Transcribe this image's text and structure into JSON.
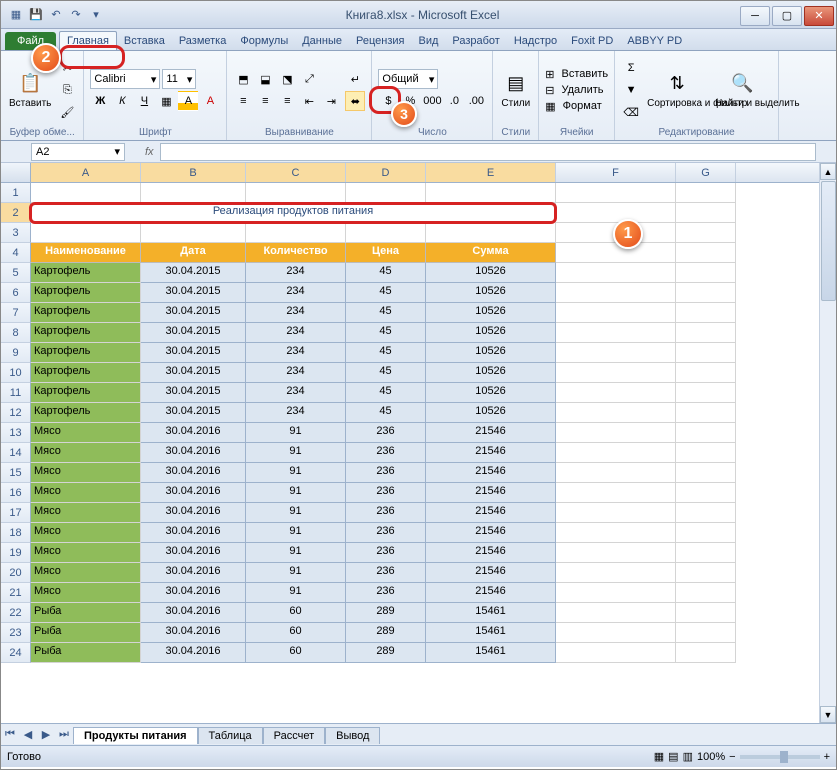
{
  "window": {
    "title": "Книга8.xlsx - Microsoft Excel"
  },
  "qat": {
    "save": "💾",
    "undo": "↶",
    "redo": "↷"
  },
  "tabs": {
    "file": "Файл",
    "items": [
      "Главная",
      "Вставка",
      "Разметка",
      "Формулы",
      "Данные",
      "Рецензия",
      "Вид",
      "Разработ",
      "Надстро",
      "Foxit PD",
      "ABBYY PD"
    ],
    "active": 0
  },
  "ribbon": {
    "clipboard": {
      "title": "Буфер обме...",
      "paste": "Вставить"
    },
    "font": {
      "title": "Шрифт",
      "name": "Calibri",
      "size": "11",
      "bold": "Ж",
      "italic": "К",
      "underline": "Ч"
    },
    "alignment": {
      "title": "Выравнивание"
    },
    "number": {
      "title": "Число",
      "format": "Общий"
    },
    "styles": {
      "title": "Стили",
      "label": "Стили"
    },
    "cells": {
      "title": "Ячейки",
      "insert": "Вставить",
      "delete": "Удалить",
      "format": "Формат"
    },
    "editing": {
      "title": "Редактирование",
      "sort": "Сортировка и фильтр",
      "find": "Найти и выделить"
    }
  },
  "namebox": "A2",
  "formula": "",
  "columns": [
    "A",
    "B",
    "C",
    "D",
    "E",
    "F",
    "G"
  ],
  "sheet_title": "Реализация продуктов питания",
  "headers": [
    "Наименование",
    "Дата",
    "Количество",
    "Цена",
    "Сумма"
  ],
  "rows": [
    {
      "n": 5,
      "a": "Картофель",
      "b": "30.04.2015",
      "c": "234",
      "d": "45",
      "e": "10526"
    },
    {
      "n": 6,
      "a": "Картофель",
      "b": "30.04.2015",
      "c": "234",
      "d": "45",
      "e": "10526"
    },
    {
      "n": 7,
      "a": "Картофель",
      "b": "30.04.2015",
      "c": "234",
      "d": "45",
      "e": "10526"
    },
    {
      "n": 8,
      "a": "Картофель",
      "b": "30.04.2015",
      "c": "234",
      "d": "45",
      "e": "10526"
    },
    {
      "n": 9,
      "a": "Картофель",
      "b": "30.04.2015",
      "c": "234",
      "d": "45",
      "e": "10526"
    },
    {
      "n": 10,
      "a": "Картофель",
      "b": "30.04.2015",
      "c": "234",
      "d": "45",
      "e": "10526"
    },
    {
      "n": 11,
      "a": "Картофель",
      "b": "30.04.2015",
      "c": "234",
      "d": "45",
      "e": "10526"
    },
    {
      "n": 12,
      "a": "Картофель",
      "b": "30.04.2015",
      "c": "234",
      "d": "45",
      "e": "10526"
    },
    {
      "n": 13,
      "a": "Мясо",
      "b": "30.04.2016",
      "c": "91",
      "d": "236",
      "e": "21546"
    },
    {
      "n": 14,
      "a": "Мясо",
      "b": "30.04.2016",
      "c": "91",
      "d": "236",
      "e": "21546"
    },
    {
      "n": 15,
      "a": "Мясо",
      "b": "30.04.2016",
      "c": "91",
      "d": "236",
      "e": "21546"
    },
    {
      "n": 16,
      "a": "Мясо",
      "b": "30.04.2016",
      "c": "91",
      "d": "236",
      "e": "21546"
    },
    {
      "n": 17,
      "a": "Мясо",
      "b": "30.04.2016",
      "c": "91",
      "d": "236",
      "e": "21546"
    },
    {
      "n": 18,
      "a": "Мясо",
      "b": "30.04.2016",
      "c": "91",
      "d": "236",
      "e": "21546"
    },
    {
      "n": 19,
      "a": "Мясо",
      "b": "30.04.2016",
      "c": "91",
      "d": "236",
      "e": "21546"
    },
    {
      "n": 20,
      "a": "Мясо",
      "b": "30.04.2016",
      "c": "91",
      "d": "236",
      "e": "21546"
    },
    {
      "n": 21,
      "a": "Мясо",
      "b": "30.04.2016",
      "c": "91",
      "d": "236",
      "e": "21546"
    },
    {
      "n": 22,
      "a": "Рыба",
      "b": "30.04.2016",
      "c": "60",
      "d": "289",
      "e": "15461"
    },
    {
      "n": 23,
      "a": "Рыба",
      "b": "30.04.2016",
      "c": "60",
      "d": "289",
      "e": "15461"
    },
    {
      "n": 24,
      "a": "Рыба",
      "b": "30.04.2016",
      "c": "60",
      "d": "289",
      "e": "15461"
    }
  ],
  "sheets": [
    "Продукты питания",
    "Таблица",
    "Рассчет",
    "Вывод"
  ],
  "status": {
    "ready": "Готово",
    "zoom": "100%"
  },
  "callouts": {
    "c1": "1",
    "c2": "2",
    "c3": "3"
  }
}
